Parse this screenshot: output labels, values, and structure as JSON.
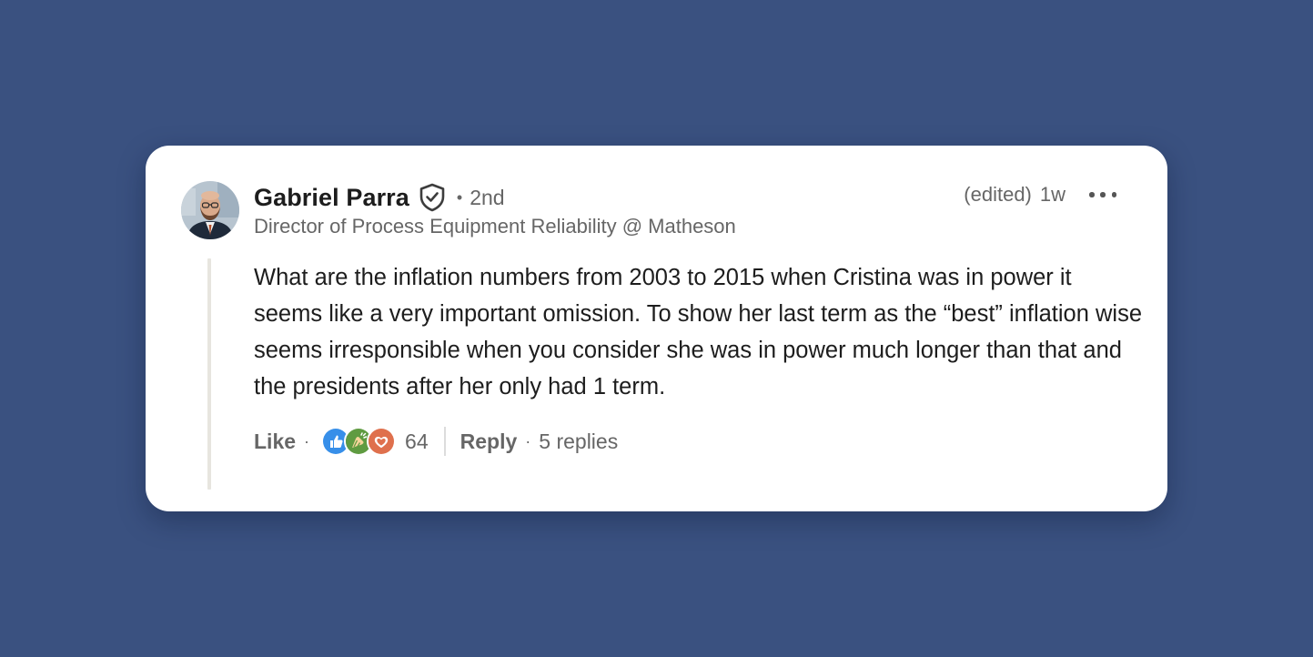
{
  "comment": {
    "author": {
      "name": "Gabriel Parra",
      "connection": "2nd",
      "headline": "Director of Process Equipment Reliability @ Matheson",
      "verified_icon": "verified-shield-icon"
    },
    "edited_label": "(edited)",
    "timestamp": "1w",
    "more_icon": "more-horizontal-icon",
    "text": "What are the inflation numbers from 2003 to 2015 when Cristina was in power it seems like a very important omission. To show her last term as the “best” inflation wise seems irresponsible when you consider she was in power much longer than that and the presidents after her only had 1 term.",
    "actions": {
      "like_label": "Like",
      "reaction_icons": [
        "like-reaction-icon",
        "celebrate-reaction-icon",
        "love-reaction-icon"
      ],
      "reaction_count": "64",
      "reply_label": "Reply",
      "replies_label": "5 replies"
    }
  },
  "colors": {
    "background": "#3a5180",
    "card": "#ffffff",
    "text_primary": "#1d1d1d",
    "text_secondary": "#666666",
    "like_blue": "#378fe9",
    "celebrate_green": "#5f9b41",
    "love_orange": "#df704d"
  }
}
